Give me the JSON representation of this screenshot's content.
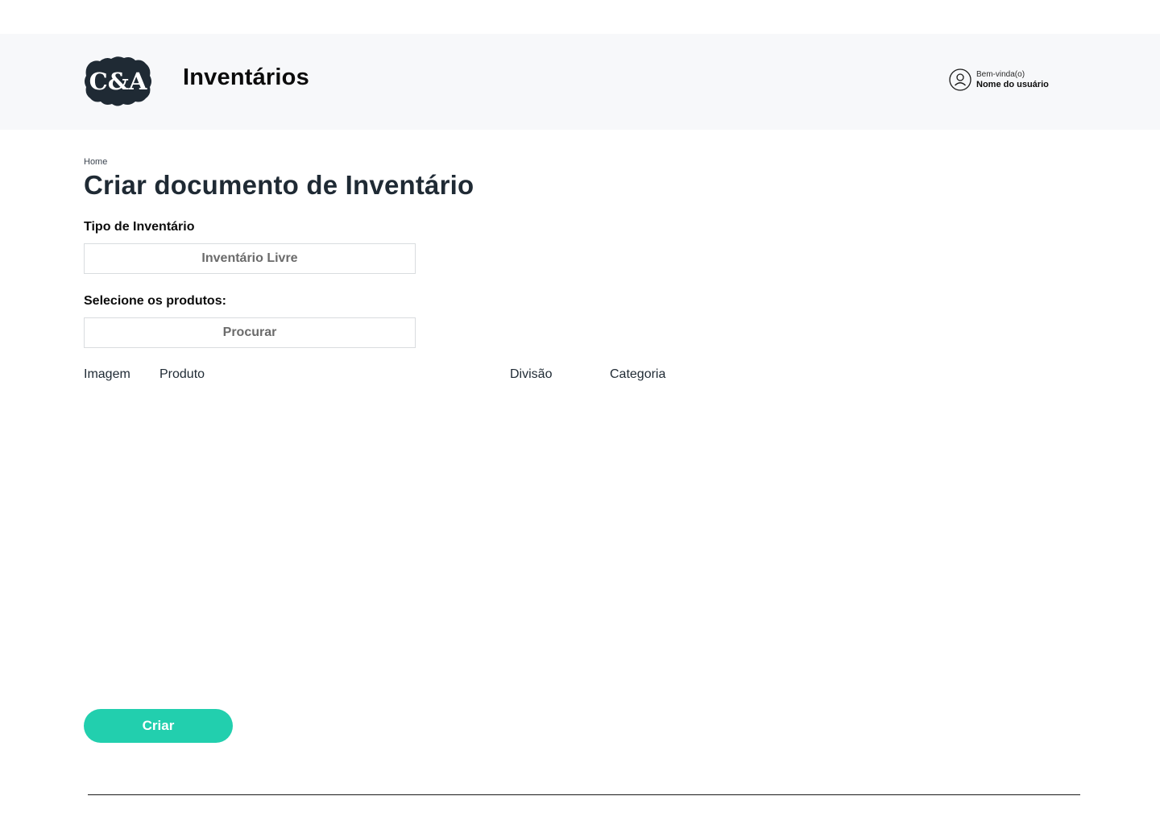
{
  "header": {
    "logo_text": "C&A",
    "title": "Inventários",
    "user": {
      "greeting": "Bem-vinda(o)",
      "name": "Nome do usuário"
    }
  },
  "breadcrumb": "Home",
  "page_title": "Criar documento de Inventário",
  "inventory_type": {
    "label": "Tipo de Inventário",
    "value": "Inventário Livre"
  },
  "product_select": {
    "label": "Selecione os produtos:",
    "placeholder": "Procurar"
  },
  "table": {
    "columns": [
      "Imagem",
      "Produto",
      "Divisão",
      "Categoria"
    ],
    "rows": []
  },
  "actions": {
    "create_label": "Criar"
  },
  "colors": {
    "header_bg": "#f7f8fa",
    "logo_bg": "#1f2a34",
    "accent": "#22cfae",
    "title_text": "#1f2a34"
  }
}
